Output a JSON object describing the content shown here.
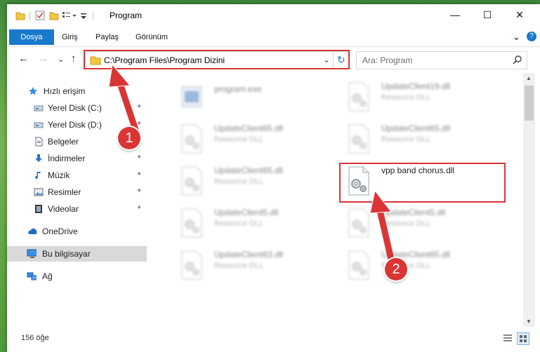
{
  "window": {
    "title": "Program",
    "minimize": "—",
    "maximize": "☐",
    "close": "✕"
  },
  "ribbon": {
    "tabs": [
      "Dosya",
      "Giriş",
      "Paylaş",
      "Görünüm"
    ],
    "collapse": "⌄",
    "help": "?"
  },
  "navigation": {
    "back": "←",
    "forward": "→",
    "recent": "⌄",
    "up": "↑"
  },
  "address": {
    "path": "C:\\Program Files\\Program Dizini",
    "dropdown": "⌄",
    "refresh": "↻"
  },
  "search": {
    "placeholder": "Ara: Program",
    "icon": "search-icon"
  },
  "sidebar": {
    "items": [
      {
        "label": "Hızlı erişim",
        "icon": "star-icon"
      },
      {
        "label": "Yerel Disk (C:)",
        "icon": "drive-icon",
        "pinned": true
      },
      {
        "label": "Yerel Disk (D:)",
        "icon": "drive-icon",
        "pinned": true
      },
      {
        "label": "Belgeler",
        "icon": "document-icon",
        "pinned": true
      },
      {
        "label": "İndirmeler",
        "icon": "download-icon",
        "pinned": true
      },
      {
        "label": "Müzik",
        "icon": "music-icon",
        "pinned": true
      },
      {
        "label": "Resimler",
        "icon": "pictures-icon",
        "pinned": true
      },
      {
        "label": "Videolar",
        "icon": "video-icon",
        "pinned": true
      },
      {
        "label": "OneDrive",
        "icon": "cloud-icon"
      },
      {
        "label": "Bu bilgisayar",
        "icon": "computer-icon",
        "selected": true
      },
      {
        "label": "Ağ",
        "icon": "network-icon"
      }
    ],
    "pin_glyph": "📌"
  },
  "files": [
    {
      "name": "program.exe",
      "type": "",
      "blurred": true
    },
    {
      "name": "UpdateClient19.dll",
      "type": "Resource DLL",
      "blurred": true
    },
    {
      "name": "UpdateClient65.dll",
      "type": "Resource DLL",
      "blurred": true
    },
    {
      "name": "UpdateClient65.dll",
      "type": "Resource DLL",
      "blurred": true
    },
    {
      "name": "UpdateClient65.dll",
      "type": "Resource DLL",
      "blurred": true
    },
    {
      "name": "vpp band chorus.dll",
      "type": "",
      "blurred": false
    },
    {
      "name": "UpdateClient5.dll",
      "type": "Resource DLL",
      "blurred": true
    },
    {
      "name": "UpdateClient5.dll",
      "type": "Resource DLL",
      "blurred": true
    },
    {
      "name": "UpdateClient63.dll",
      "type": "Resource DLL",
      "blurred": true
    },
    {
      "name": "UpdateClient65.dll",
      "type": "Resource DLL",
      "blurred": true
    }
  ],
  "status": {
    "count": "156 öğe"
  },
  "annotations": {
    "step1": "1",
    "step2": "2",
    "color": "#d93535"
  },
  "colors": {
    "accent": "#1979ca",
    "selection": "#d9d9d9"
  }
}
